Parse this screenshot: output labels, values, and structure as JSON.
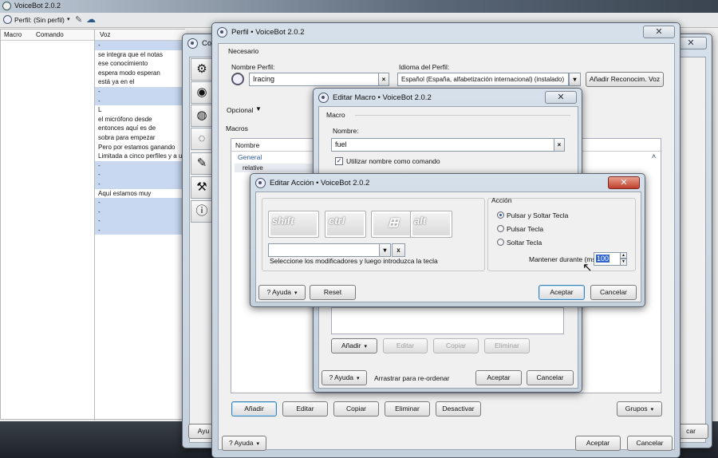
{
  "main": {
    "title": "VoiceBot 2.0.2",
    "profile_label": "Perfil: (Sin perfil)",
    "columns": [
      "Macro",
      "Comando",
      "Voz"
    ],
    "voz_lines": [
      "-",
      "se integra que el notas",
      "ese conocimiento",
      "espera modo esperan",
      "está ya en el",
      "-",
      "-",
      "L",
      "el micrófono desde",
      "entonces aquí es de",
      "sobra para empezar",
      "Pero por estamos ganando",
      "Limitada a cinco perfiles y a u",
      "-",
      "-",
      "-",
      "Aquí estamos muy",
      "-",
      "-",
      "-",
      "-"
    ]
  },
  "config": {
    "title": "Confi",
    "ayuda_partial": "Ayu",
    "cancel_partial": "car"
  },
  "perfil": {
    "title": "Perfil • VoiceBot 2.0.2",
    "necesario": "Necesario",
    "nombre_label": "Nombre Perfil:",
    "nombre_value": "Iracing",
    "idioma_label": "Idioma del Perfil:",
    "idioma_value": "Español (España, alfabetización internacional) (instalado)",
    "add_recog": "Añadir Reconocim. Voz",
    "opcional": "Opcional",
    "macros": "Macros",
    "tree_header": "Nombre",
    "tree_general": "General",
    "tree_relative": "relative",
    "buttons": {
      "add": "Añadir",
      "edit": "Editar",
      "copy": "Copiar",
      "delete": "Eliminar",
      "disable": "Desactivar",
      "groups": "Grupos",
      "help": "Ayuda",
      "accept": "Aceptar",
      "cancel": "Cancelar"
    }
  },
  "macro": {
    "title": "Editar Macro • VoiceBot 2.0.2",
    "group": "Macro",
    "nombre_label": "Nombre:",
    "nombre_value": "fuel",
    "use_name": "Utilizar nombre como comando",
    "buttons": {
      "add": "Añadir",
      "edit": "Editar",
      "copy": "Copiar",
      "delete": "Eliminar",
      "help": "Ayuda",
      "reorder": "Arrastrar para re-ordenar",
      "accept": "Aceptar",
      "cancel": "Cancelar"
    }
  },
  "accion": {
    "title": "Editar Acción • VoiceBot 2.0.2",
    "keys": [
      "shift",
      "ctrl",
      "alt"
    ],
    "hint": "Seleccione los modificadores y luego introduzca la tecla",
    "accion_label": "Acción",
    "options": [
      "Pulsar y Soltar Tecla",
      "Pulsar Tecla",
      "Soltar Tecla"
    ],
    "mantener_label": "Mantener durante (ms)",
    "mantener_value": "100",
    "buttons": {
      "help": "Ayuda",
      "reset": "Reset",
      "accept": "Aceptar",
      "cancel": "Cancelar"
    }
  },
  "colors": {
    "accent": "#3c7fb1",
    "selection": "#c8d8f0",
    "close_red": "#c0402a"
  }
}
